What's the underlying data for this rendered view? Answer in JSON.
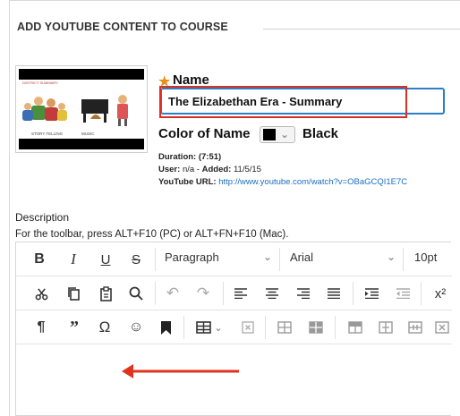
{
  "section": {
    "title": "ADD YOUTUBE CONTENT TO COURSE"
  },
  "thumbnail": {
    "caption": "DISTRICT SUMMARY",
    "label_left": "STORY TELLING",
    "label_right": "MUSIC"
  },
  "name_field": {
    "label": "Name",
    "required_mark": "★",
    "value": "The Elizabethan Era - Summary"
  },
  "color_field": {
    "label": "Color of Name",
    "value": "Black",
    "swatch_color": "#000000"
  },
  "meta": {
    "duration_label": "Duration:",
    "duration_value": "(7:51)",
    "user_label": "User:",
    "user_value": "n/a",
    "added_label": "Added:",
    "added_value": "11/5/15",
    "url_label": "YouTube URL:",
    "url_value": "http://www.youtube.com/watch?v=OBaGCQI1E7C"
  },
  "description": {
    "label": "Description",
    "hint": "For the toolbar, press ALT+F10 (PC) or ALT+FN+F10 (Mac)."
  },
  "toolbar": {
    "paragraph_select": "Paragraph",
    "font_select": "Arial",
    "size_select": "10pt"
  },
  "colors": {
    "accent": "#2a7fc7",
    "highlight_box": "#d93025",
    "required": "#e8911a",
    "link": "#1a6fc2"
  }
}
